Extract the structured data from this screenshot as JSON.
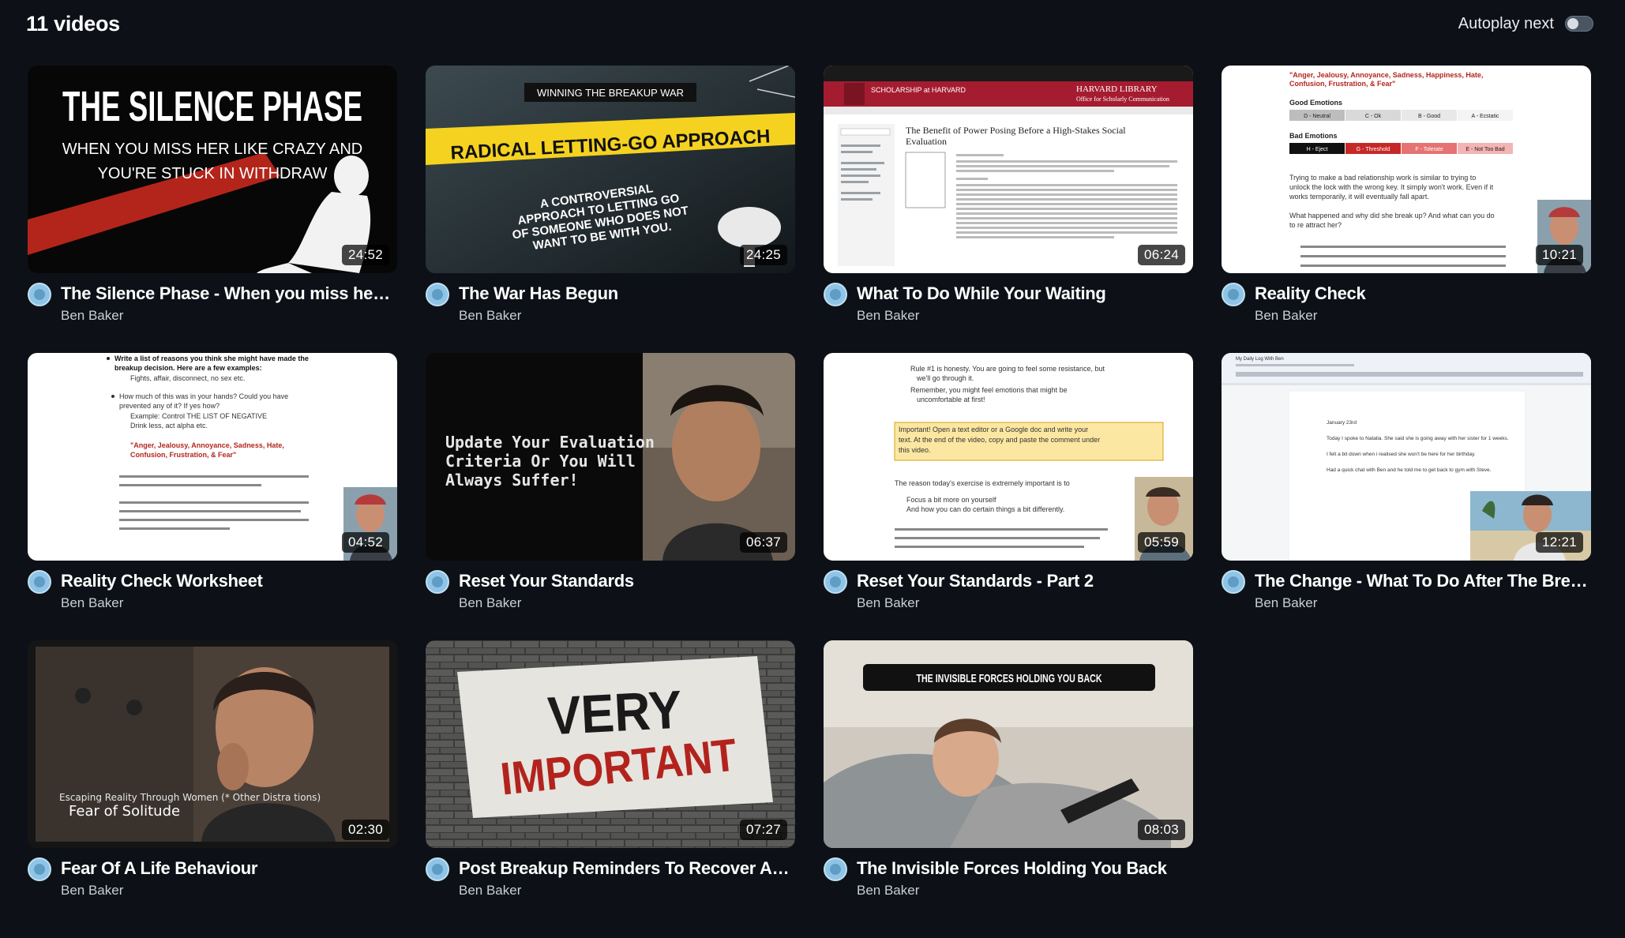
{
  "header": {
    "video_count": "11 videos",
    "autoplay_label": "Autoplay next",
    "autoplay_enabled": false
  },
  "videos": [
    {
      "title": "The Silence Phase - When you miss her like crazy and you're stuck in withdraw",
      "author": "Ben Baker",
      "duration": "24:52",
      "thumb": {
        "line1": "THE SILENCE PHASE",
        "line2": "WHEN YOU MISS HER LIKE CRAZY AND",
        "line3": "YOU'RE STUCK IN WITHDRAW"
      }
    },
    {
      "title": "The War Has Begun",
      "author": "Ben Baker",
      "duration": "24:25",
      "thumb": {
        "line1": "WINNING THE BREAKUP WAR",
        "line2": "RADICAL LETTING-GO APPROACH",
        "line3": "A CONTROVERSIAL",
        "line4": "APPROACH TO LETTING GO",
        "line5": "OF SOMEONE WHO DOES NOT",
        "line6": "WANT TO BE WITH YOU."
      }
    },
    {
      "title": "What To Do While Your Waiting",
      "author": "Ben Baker",
      "duration": "06:24",
      "thumb": {
        "line1": "SCHOLARSHIP at HARVARD",
        "line2": "HARVARD LIBRARY",
        "line3": "Office for Scholarly Communication",
        "line4": "The Benefit of Power Posing Before a High-Stakes Social",
        "line5": "Evaluation"
      }
    },
    {
      "title": "Reality Check",
      "author": "Ben Baker",
      "duration": "10:21",
      "thumb": {
        "line1": "\"Anger, Jealousy, Annoyance, Sadness, Happiness, Hate,",
        "line2": "Confusion, Frustration, & Fear\"",
        "line3": "Good Emotions",
        "line4": "Bad Emotions",
        "cells_good": [
          "D - Neutral",
          "C - Ok",
          "B - Good",
          "A - Ecstatic"
        ],
        "cells_bad": [
          "H - Eject",
          "G - Threshold",
          "F - Tolerate",
          "E - Not Too Bad"
        ],
        "line5": "Trying to make a bad relationship work is similar to trying to",
        "line6": "unlock the lock with the wrong key. It simply won't work. Even if it",
        "line7": "works temporarily, it will eventually fall apart.",
        "line8": "What happened and why did she break up? And what can you do",
        "line9": "to re attract her?"
      }
    },
    {
      "title": "Reality Check Worksheet",
      "author": "Ben Baker",
      "duration": "04:52",
      "thumb": {
        "line1": "Write a list of reasons you think she might have made the",
        "line2": "breakup decision. Here are a few examples:",
        "line3": "Fights, affair, disconnect, no sex etc.",
        "line4": "How much of this was in your hands? Could you have",
        "line5": "prevented any of it? If yes how?",
        "line6": "Example: Control THE LIST OF NEGATIVE",
        "line7": "Drink less, act alpha etc.",
        "line8": "\"Anger, Jealousy, Annoyance, Sadness, Hate,",
        "line9": "Confusion, Frustration, & Fear\""
      }
    },
    {
      "title": "Reset Your Standards",
      "author": "Ben Baker",
      "duration": "06:37",
      "thumb": {
        "line1": "Update Your Evaluation",
        "line2": "Criteria Or You Will",
        "line3": "Always Suffer!"
      }
    },
    {
      "title": "Reset Your Standards - Part 2",
      "author": "Ben Baker",
      "duration": "05:59",
      "thumb": {
        "line1": "Rule #1 is honesty. You are going to feel some resistance, but",
        "line2": "we'll go through it.",
        "line3": "Remember, you might feel emotions that might be",
        "line4": "uncomfortable at first!",
        "line5": "Important! Open a text editor or a Google doc and write your",
        "line6": "text. At the end of the video, copy and paste the comment under",
        "line7": "this video.",
        "line8": "The reason today's exercise is extremely important is to",
        "line9": "Focus a bit more on yourself",
        "line10": "And how you can do certain things a bit differently."
      }
    },
    {
      "title": "The Change - What To Do After The Breakup",
      "author": "Ben Baker",
      "duration": "12:21",
      "thumb": {
        "line1": "My Daily Log With Ben",
        "line2": "January 23rd",
        "line3": "Today I spoke to Natalia. She said she is going away with her sister for 1 weeks.",
        "line4": "I felt a bit down when i realised she won't be here for her birthday.",
        "line5": "Had a quick chat with Ben and he told me to get back to gym with Steve."
      }
    },
    {
      "title": "Fear Of A Life Behaviour",
      "author": "Ben Baker",
      "duration": "02:30",
      "thumb": {
        "line1": "Escaping Reality Through Women (* Other Distra tions)",
        "line2": "Fear of Solitude"
      }
    },
    {
      "title": "Post Breakup Reminders To Recover And Move On",
      "author": "Ben Baker",
      "duration": "07:27",
      "thumb": {
        "line1": "VERY",
        "line2": "IMPORTANT"
      }
    },
    {
      "title": "The Invisible Forces Holding You Back",
      "author": "Ben Baker",
      "duration": "08:03",
      "thumb": {
        "line1": "THE INVISIBLE FORCES HOLDING YOU BACK"
      }
    }
  ]
}
